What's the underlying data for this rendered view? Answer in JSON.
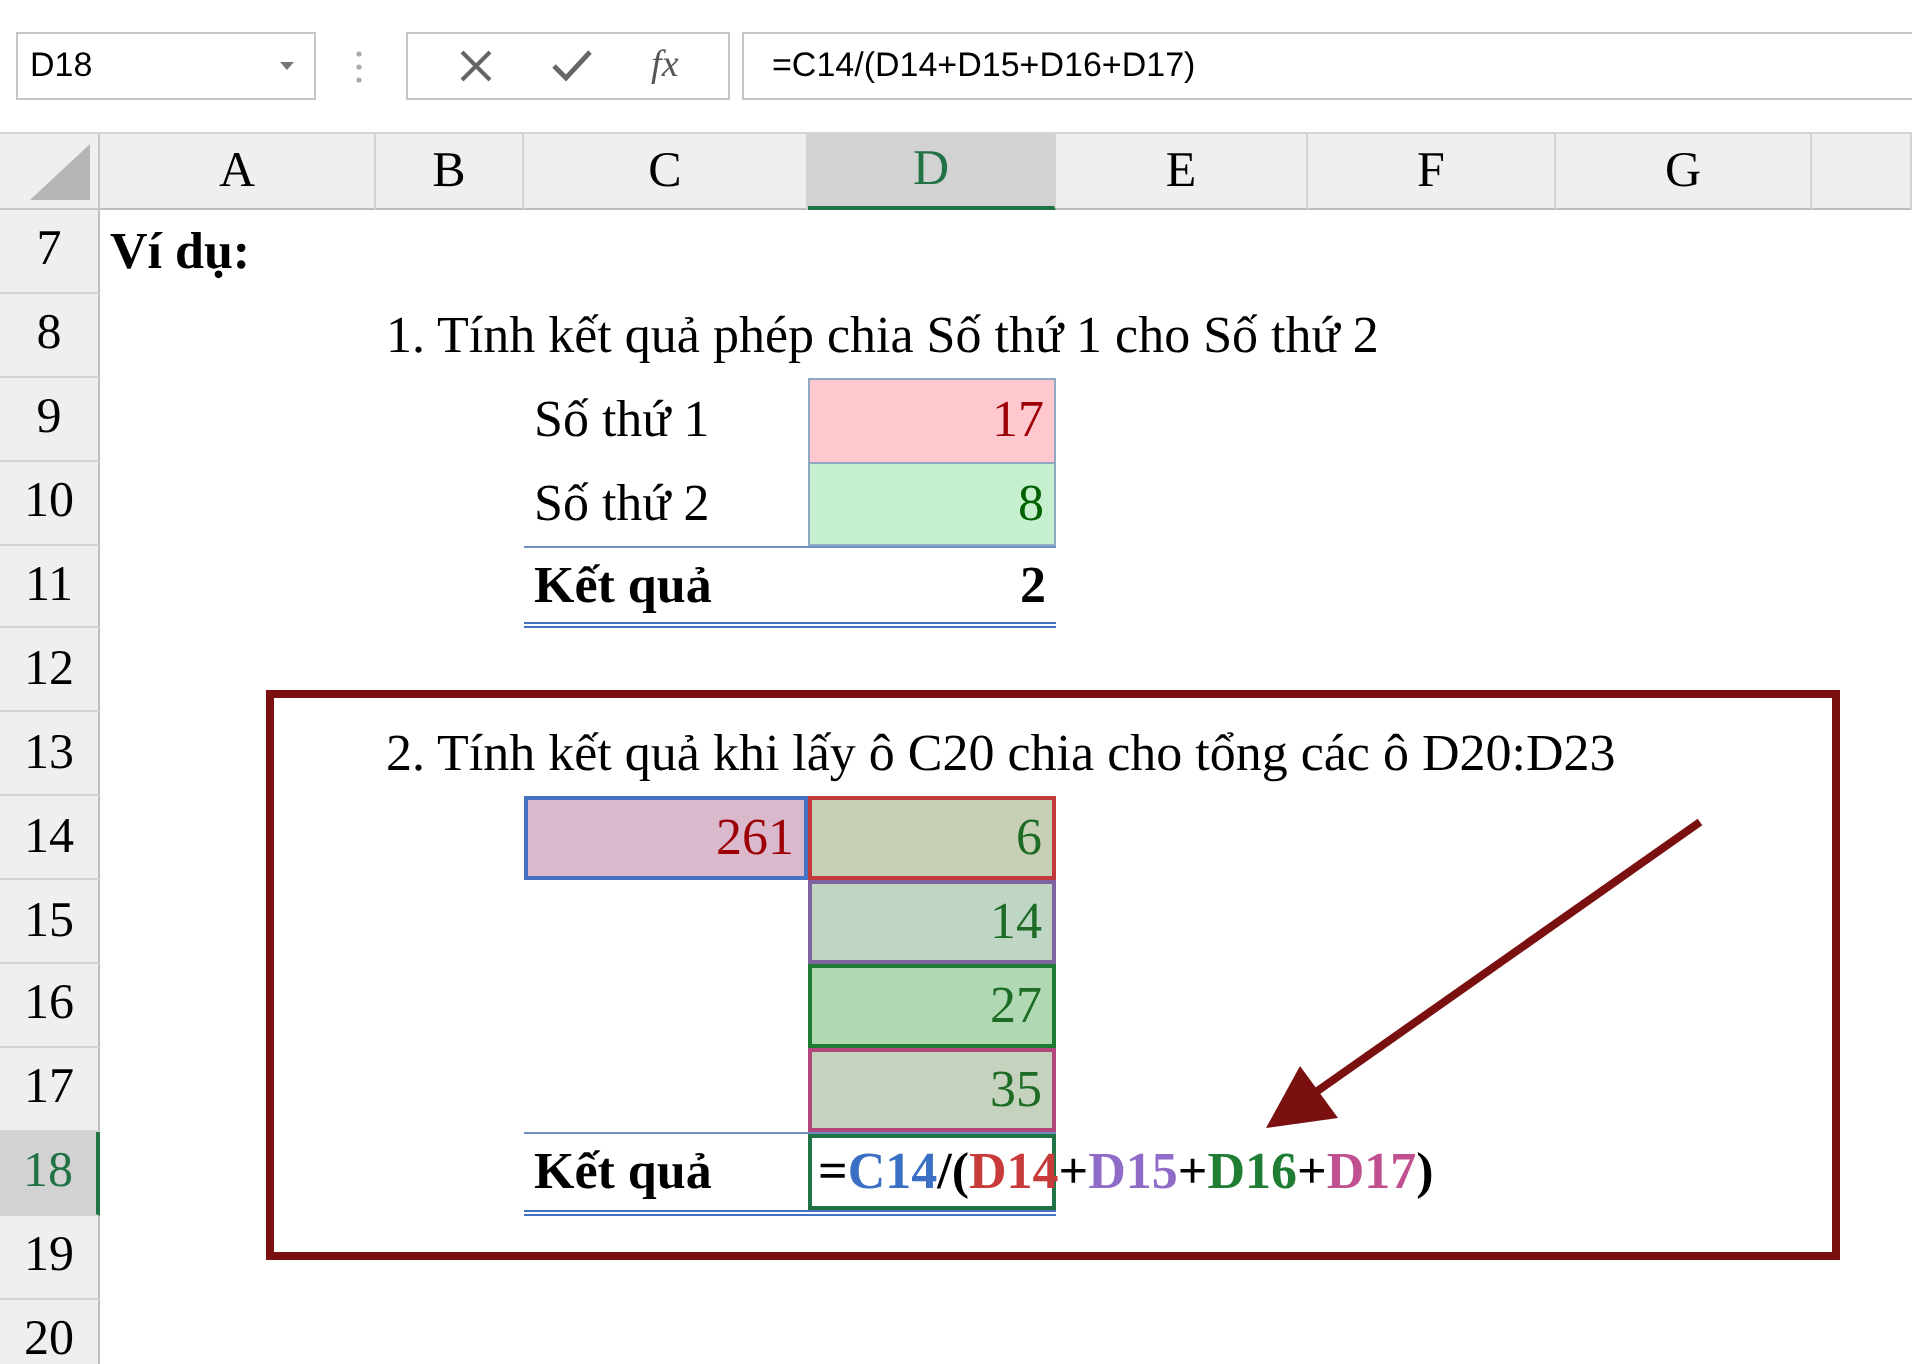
{
  "name_box": {
    "value": "D18"
  },
  "formula_bar": {
    "function_label": "fx",
    "value": "=C14/(D14+D15+D16+D17)"
  },
  "columns": [
    {
      "label": "A",
      "selected": false
    },
    {
      "label": "B",
      "selected": false
    },
    {
      "label": "C",
      "selected": false
    },
    {
      "label": "D",
      "selected": true
    },
    {
      "label": "E",
      "selected": false
    },
    {
      "label": "F",
      "selected": false
    },
    {
      "label": "G",
      "selected": false
    }
  ],
  "rows": [
    {
      "number": "7",
      "selected": false,
      "cells": {
        "A": {
          "kind": "heading",
          "text": "Ví dụ:"
        }
      }
    },
    {
      "number": "8",
      "selected": false,
      "cells": {
        "B": {
          "kind": "text",
          "text": "1. Tính kết quả phép chia Số thứ 1 cho Số thứ 2"
        }
      }
    },
    {
      "number": "9",
      "selected": false,
      "cells": {
        "C": {
          "kind": "label",
          "text": "Số thứ 1"
        },
        "D": {
          "kind": "value-a",
          "text": "17"
        }
      }
    },
    {
      "number": "10",
      "selected": false,
      "cells": {
        "C": {
          "kind": "label",
          "text": "Số thứ 2"
        },
        "D": {
          "kind": "value-b",
          "text": "8"
        }
      }
    },
    {
      "number": "11",
      "selected": false,
      "cells": {
        "C": {
          "kind": "total-label",
          "text": "Kết quả"
        },
        "D": {
          "kind": "total-value",
          "text": "2"
        }
      }
    },
    {
      "number": "12",
      "selected": false
    },
    {
      "number": "13",
      "selected": false,
      "cells": {
        "B": {
          "kind": "text",
          "text": "2. Tính kết quả khi lấy ô C20 chia cho tổng các ô D20:D23"
        }
      }
    },
    {
      "number": "14",
      "selected": false,
      "cells": {
        "C": {
          "kind": "ref-a",
          "text": "261",
          "color": "#4472c4"
        },
        "D": {
          "kind": "ref-b",
          "text": "6",
          "color": "#c0393b"
        }
      }
    },
    {
      "number": "15",
      "selected": false,
      "cells": {
        "D": {
          "kind": "ref-b",
          "text": "14",
          "color": "#8064a2"
        }
      }
    },
    {
      "number": "16",
      "selected": false,
      "cells": {
        "D": {
          "kind": "ref-b",
          "text": "27",
          "color": "#1e7b34"
        }
      }
    },
    {
      "number": "17",
      "selected": false,
      "cells": {
        "D": {
          "kind": "ref-b",
          "text": "35",
          "color": "#b0487e"
        }
      }
    },
    {
      "number": "18",
      "selected": true,
      "cells": {
        "C": {
          "kind": "total-label",
          "text": "Kết quả"
        },
        "D": {
          "kind": "formula",
          "active": true,
          "parts": [
            {
              "text": "=",
              "color": "#000000"
            },
            {
              "text": "C14",
              "color": "#3a6fc4"
            },
            {
              "text": "/(",
              "color": "#000000"
            },
            {
              "text": "D14",
              "color": "#c93b3b"
            },
            {
              "text": "+",
              "color": "#000000"
            },
            {
              "text": "D15",
              "color": "#8f6cc7"
            },
            {
              "text": "+",
              "color": "#000000"
            },
            {
              "text": "D16",
              "color": "#1f7e33"
            },
            {
              "text": "+",
              "color": "#000000"
            },
            {
              "text": "D17",
              "color": "#c0508f"
            },
            {
              "text": ")",
              "color": "#000000"
            }
          ]
        }
      }
    },
    {
      "number": "19",
      "selected": false
    },
    {
      "number": "20",
      "selected": false
    }
  ]
}
